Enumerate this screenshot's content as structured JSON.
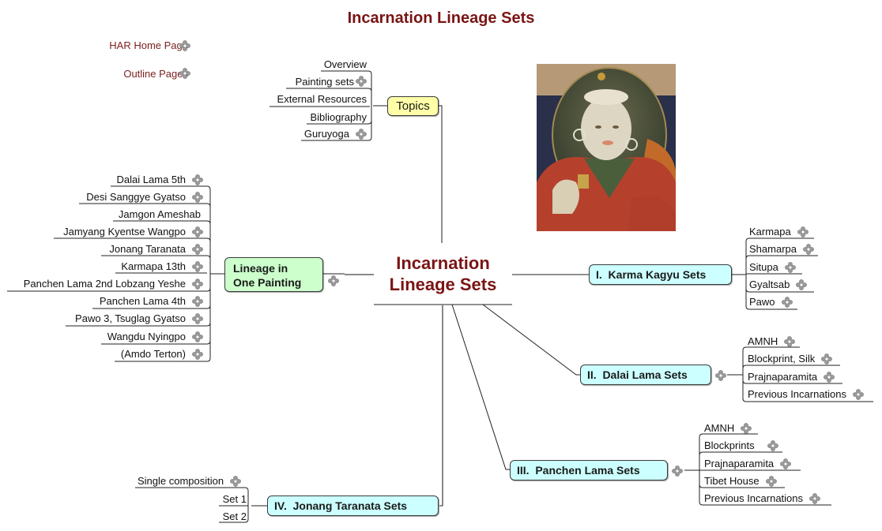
{
  "page": {
    "title": "Incarnation Lineage Sets"
  },
  "side_links": [
    {
      "label": "HAR Home Page",
      "icon": "link-icon"
    },
    {
      "label": "Outline Pages",
      "icon": "link-icon"
    }
  ],
  "central": {
    "line1": "Incarnation",
    "line2": "Lineage Sets",
    "color": "#7a1414"
  },
  "topics": {
    "label": "Topics",
    "children": [
      {
        "label": "Overview",
        "link": false
      },
      {
        "label": "Painting sets",
        "link": true
      },
      {
        "label": "External Resources",
        "link": false
      },
      {
        "label": "Bibliography",
        "link": false
      },
      {
        "label": "Guruyoga",
        "link": true
      }
    ]
  },
  "lineage_painting": {
    "line1": "Lineage in",
    "line2": "One Painting",
    "link": true,
    "children": [
      {
        "label": "Dalai Lama 5th",
        "link": true
      },
      {
        "label": "Desi Sanggye Gyatso",
        "link": true
      },
      {
        "label": "Jamgon Ameshab",
        "link": false
      },
      {
        "label": "Jamyang Kyentse Wangpo",
        "link": true
      },
      {
        "label": "Jonang Taranata",
        "link": true
      },
      {
        "label": "Karmapa 13th",
        "link": true
      },
      {
        "label": "Panchen Lama 2nd Lobzang Yeshe",
        "link": true
      },
      {
        "label": "Panchen Lama 4th",
        "link": true
      },
      {
        "label": "Pawo 3, Tsuglag Gyatso",
        "link": true
      },
      {
        "label": "Wangdu Nyingpo",
        "link": true
      },
      {
        "label": "(Amdo Terton)",
        "link": true
      }
    ]
  },
  "karma_kagyu": {
    "label": "I.  Karma Kagyu Sets",
    "link": false,
    "children": [
      {
        "label": "Karmapa",
        "link": true
      },
      {
        "label": "Shamarpa",
        "link": true
      },
      {
        "label": "Situpa",
        "link": true
      },
      {
        "label": "Gyaltsab",
        "link": true
      },
      {
        "label": "Pawo",
        "link": true
      }
    ]
  },
  "dalai_lama": {
    "label": "II.  Dalai Lama Sets",
    "link": true,
    "children": [
      {
        "label": "AMNH",
        "link": true
      },
      {
        "label": "Blockprint, Silk",
        "link": true
      },
      {
        "label": "Prajnaparamita",
        "link": true
      },
      {
        "label": "Previous Incarnations",
        "link": true
      }
    ]
  },
  "panchen_lama": {
    "label": "III.  Panchen Lama Sets",
    "link": true,
    "children": [
      {
        "label": "AMNH",
        "link": true
      },
      {
        "label": "Blockprints",
        "link": true
      },
      {
        "label": "Prajnaparamita",
        "link": true
      },
      {
        "label": "Tibet House",
        "link": true
      },
      {
        "label": "Previous Incarnations",
        "link": true
      }
    ]
  },
  "jonang": {
    "label": "IV.  Jonang Taranata Sets",
    "link": false,
    "children": [
      {
        "label": "Single composition",
        "link": true
      },
      {
        "label": "Set 1",
        "link": false
      },
      {
        "label": "Set 2",
        "link": false
      }
    ]
  },
  "portrait": {
    "alt": "Portrait painting of a lama"
  },
  "colors": {
    "title": "#7a1414",
    "link_text": "#7a1f1f",
    "topics_fill": "#ffffa8",
    "lineage_fill": "#ccffcc",
    "sets_fill": "#ccffff"
  }
}
